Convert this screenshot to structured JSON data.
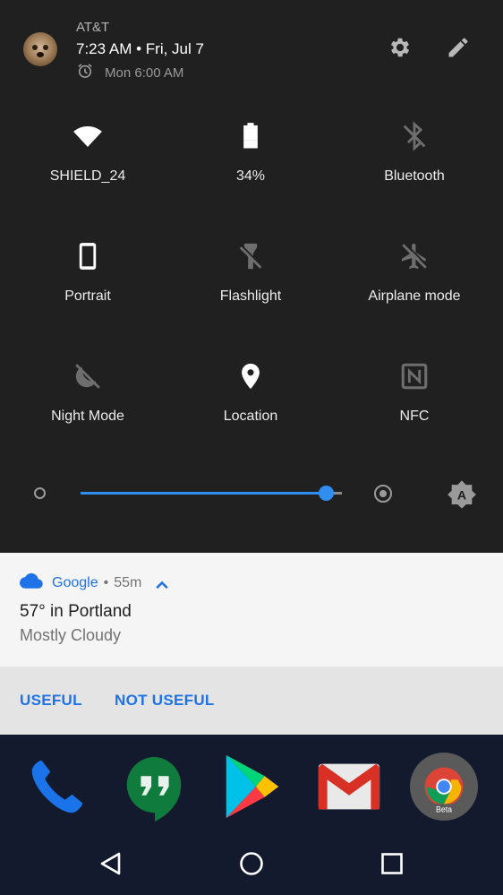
{
  "status": {
    "carrier": "AT&T",
    "datetime": "7:23 AM • Fri, Jul 7",
    "alarm": "Mon 6:00 AM"
  },
  "header_icons": {
    "settings": "gear-icon",
    "edit": "pencil-icon"
  },
  "tiles": [
    {
      "label": "SHIELD_24",
      "icon": "wifi-icon",
      "active": true
    },
    {
      "label": "34%",
      "icon": "battery-icon",
      "active": true
    },
    {
      "label": "Bluetooth",
      "icon": "bluetooth-off-icon",
      "active": false
    },
    {
      "label": "Portrait",
      "icon": "portrait-icon",
      "active": true
    },
    {
      "label": "Flashlight",
      "icon": "flashlight-off-icon",
      "active": false
    },
    {
      "label": "Airplane mode",
      "icon": "airplane-off-icon",
      "active": false
    },
    {
      "label": "Night Mode",
      "icon": "night-mode-off-icon",
      "active": false
    },
    {
      "label": "Location",
      "icon": "location-icon",
      "active": true
    },
    {
      "label": "NFC",
      "icon": "nfc-icon",
      "active": false
    }
  ],
  "brightness": {
    "level": 0.94,
    "auto": "A"
  },
  "notification": {
    "app": "Google",
    "separator": "•",
    "time": "55m",
    "title": "57° in Portland",
    "text": "Mostly Cloudy",
    "actions": [
      "USEFUL",
      "NOT USEFUL"
    ]
  },
  "dock": {
    "apps": [
      "Phone",
      "Hangouts",
      "Play Store",
      "Gmail",
      "Chrome Beta"
    ],
    "chrome_badge": "Beta"
  },
  "colors": {
    "accent": "#2f8ef0",
    "link": "#1f73e6",
    "panel_bg": "#202020",
    "active_icon": "#ffffff",
    "inactive_icon": "#6e6e6e"
  }
}
